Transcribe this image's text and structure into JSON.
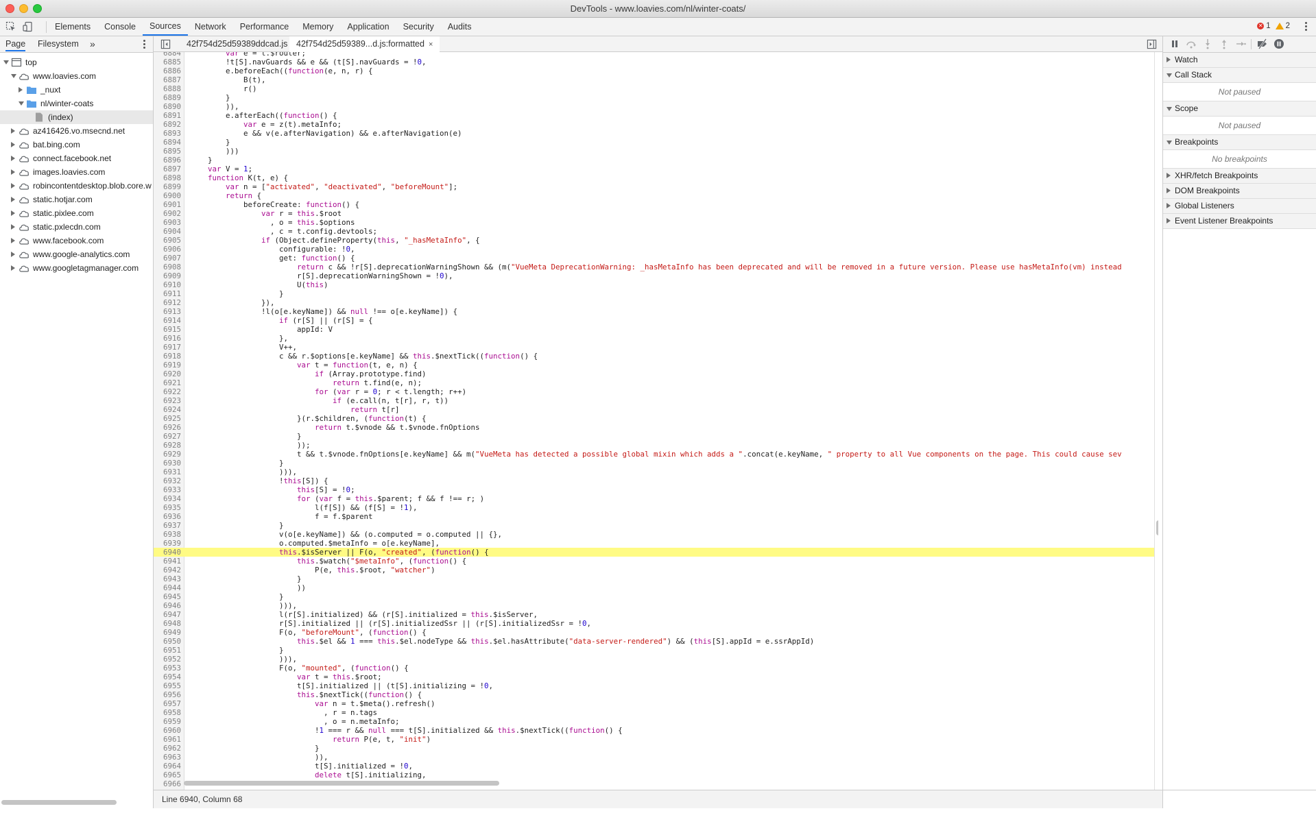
{
  "window": {
    "title": "DevTools - www.loavies.com/nl/winter-coats/"
  },
  "toolbar": {
    "tabs": [
      "Elements",
      "Console",
      "Sources",
      "Network",
      "Performance",
      "Memory",
      "Application",
      "Security",
      "Audits"
    ],
    "active_tab": "Sources",
    "errors": "1",
    "warnings": "2"
  },
  "navigator": {
    "tabs": [
      "Page",
      "Filesystem"
    ],
    "more": "»",
    "tree": [
      {
        "label": "top",
        "level": 0,
        "expanded": true,
        "icon": "frame"
      },
      {
        "label": "www.loavies.com",
        "level": 1,
        "expanded": true,
        "icon": "cloud"
      },
      {
        "label": "_nuxt",
        "level": 2,
        "expanded": false,
        "icon": "folder"
      },
      {
        "label": "nl/winter-coats",
        "level": 2,
        "expanded": true,
        "icon": "folder"
      },
      {
        "label": "(index)",
        "level": 3,
        "icon": "file",
        "selected": true
      },
      {
        "label": "az416426.vo.msecnd.net",
        "level": 1,
        "expanded": false,
        "icon": "cloud"
      },
      {
        "label": "bat.bing.com",
        "level": 1,
        "expanded": false,
        "icon": "cloud"
      },
      {
        "label": "connect.facebook.net",
        "level": 1,
        "expanded": false,
        "icon": "cloud"
      },
      {
        "label": "images.loavies.com",
        "level": 1,
        "expanded": false,
        "icon": "cloud"
      },
      {
        "label": "robincontentdesktop.blob.core.w",
        "level": 1,
        "expanded": false,
        "icon": "cloud"
      },
      {
        "label": "static.hotjar.com",
        "level": 1,
        "expanded": false,
        "icon": "cloud"
      },
      {
        "label": "static.pixlee.com",
        "level": 1,
        "expanded": false,
        "icon": "cloud"
      },
      {
        "label": "static.pxlecdn.com",
        "level": 1,
        "expanded": false,
        "icon": "cloud"
      },
      {
        "label": "www.facebook.com",
        "level": 1,
        "expanded": false,
        "icon": "cloud"
      },
      {
        "label": "www.google-analytics.com",
        "level": 1,
        "expanded": false,
        "icon": "cloud"
      },
      {
        "label": "www.googletagmanager.com",
        "level": 1,
        "expanded": false,
        "icon": "cloud"
      }
    ]
  },
  "editor": {
    "tabs": [
      {
        "label": "42f754d25d59389ddcad.js",
        "closable": false
      },
      {
        "label": "42f754d25d59389...d.js:formatted",
        "closable": true,
        "close": "×"
      }
    ],
    "status": "Line 6940, Column 68",
    "highlighted_line": 6940,
    "lines": [
      {
        "n": "6884",
        "t": "        var e = t.$router;"
      },
      {
        "n": "6885",
        "t": "        !t[S].navGuards && e && (t[S].navGuards = !0,"
      },
      {
        "n": "6886",
        "t": "        e.beforeEach((function(e, n, r) {"
      },
      {
        "n": "6887",
        "t": "            B(t),"
      },
      {
        "n": "6888",
        "t": "            r()"
      },
      {
        "n": "6889",
        "t": "        }"
      },
      {
        "n": "6890",
        "t": "        )),"
      },
      {
        "n": "6891",
        "t": "        e.afterEach((function() {"
      },
      {
        "n": "6892",
        "t": "            var e = z(t).metaInfo;"
      },
      {
        "n": "6893",
        "t": "            e && v(e.afterNavigation) && e.afterNavigation(e)"
      },
      {
        "n": "6894",
        "t": "        }"
      },
      {
        "n": "6895",
        "t": "        )))"
      },
      {
        "n": "6896",
        "t": "    }"
      },
      {
        "n": "6897",
        "t": "    var V = 1;"
      },
      {
        "n": "6898",
        "t": "    function K(t, e) {"
      },
      {
        "n": "6899",
        "t": "        var n = [\"activated\", \"deactivated\", \"beforeMount\"];"
      },
      {
        "n": "6900",
        "t": "        return {"
      },
      {
        "n": "6901",
        "t": "            beforeCreate: function() {"
      },
      {
        "n": "6902",
        "t": "                var r = this.$root"
      },
      {
        "n": "6903",
        "t": "                  , o = this.$options"
      },
      {
        "n": "6904",
        "t": "                  , c = t.config.devtools;"
      },
      {
        "n": "6905",
        "t": "                if (Object.defineProperty(this, \"_hasMetaInfo\", {"
      },
      {
        "n": "6906",
        "t": "                    configurable: !0,"
      },
      {
        "n": "6907",
        "t": "                    get: function() {"
      },
      {
        "n": "6908",
        "t": "                        return c && !r[S].deprecationWarningShown && (m(\"VueMeta DeprecationWarning: _hasMetaInfo has been deprecated and will be removed in a future version. Please use hasMetaInfo(vm) instead"
      },
      {
        "n": "6909",
        "t": "                        r[S].deprecationWarningShown = !0),"
      },
      {
        "n": "6910",
        "t": "                        U(this)"
      },
      {
        "n": "6911",
        "t": "                    }"
      },
      {
        "n": "6912",
        "t": "                }),"
      },
      {
        "n": "6913",
        "t": "                !l(o[e.keyName]) && null !== o[e.keyName]) {"
      },
      {
        "n": "6914",
        "t": "                    if (r[S] || (r[S] = {"
      },
      {
        "n": "6915",
        "t": "                        appId: V"
      },
      {
        "n": "6916",
        "t": "                    },"
      },
      {
        "n": "6917",
        "t": "                    V++,"
      },
      {
        "n": "6918",
        "t": "                    c && r.$options[e.keyName] && this.$nextTick((function() {"
      },
      {
        "n": "6919",
        "t": "                        var t = function(t, e, n) {"
      },
      {
        "n": "6920",
        "t": "                            if (Array.prototype.find)"
      },
      {
        "n": "6921",
        "t": "                                return t.find(e, n);"
      },
      {
        "n": "6922",
        "t": "                            for (var r = 0; r < t.length; r++)"
      },
      {
        "n": "6923",
        "t": "                                if (e.call(n, t[r], r, t))"
      },
      {
        "n": "6924",
        "t": "                                    return t[r]"
      },
      {
        "n": "6925",
        "t": "                        }(r.$children, (function(t) {"
      },
      {
        "n": "6926",
        "t": "                            return t.$vnode && t.$vnode.fnOptions"
      },
      {
        "n": "6927",
        "t": "                        }"
      },
      {
        "n": "6928",
        "t": "                        ));"
      },
      {
        "n": "6929",
        "t": "                        t && t.$vnode.fnOptions[e.keyName] && m(\"VueMeta has detected a possible global mixin which adds a \".concat(e.keyName, \" property to all Vue components on the page. This could cause sev"
      },
      {
        "n": "6930",
        "t": "                    }"
      },
      {
        "n": "6931",
        "t": "                    ))),"
      },
      {
        "n": "6932",
        "t": "                    !this[S]) {"
      },
      {
        "n": "6933",
        "t": "                        this[S] = !0;"
      },
      {
        "n": "6934",
        "t": "                        for (var f = this.$parent; f && f !== r; )"
      },
      {
        "n": "6935",
        "t": "                            l(f[S]) && (f[S] = !1),"
      },
      {
        "n": "6936",
        "t": "                            f = f.$parent"
      },
      {
        "n": "6937",
        "t": "                    }"
      },
      {
        "n": "6938",
        "t": "                    v(o[e.keyName]) && (o.computed = o.computed || {},"
      },
      {
        "n": "6939",
        "t": "                    o.computed.$metaInfo = o[e.keyName],"
      },
      {
        "n": "6940",
        "t": "                    this.$isServer || F(o, \"created\", (function() {"
      },
      {
        "n": "6941",
        "t": "                        this.$watch(\"$metaInfo\", (function() {"
      },
      {
        "n": "6942",
        "t": "                            P(e, this.$root, \"watcher\")"
      },
      {
        "n": "6943",
        "t": "                        }"
      },
      {
        "n": "6944",
        "t": "                        ))"
      },
      {
        "n": "6945",
        "t": "                    }"
      },
      {
        "n": "6946",
        "t": "                    ))),"
      },
      {
        "n": "6947",
        "t": "                    l(r[S].initialized) && (r[S].initialized = this.$isServer,"
      },
      {
        "n": "6948",
        "t": "                    r[S].initialized || (r[S].initializedSsr || (r[S].initializedSsr = !0,"
      },
      {
        "n": "6949",
        "t": "                    F(o, \"beforeMount\", (function() {"
      },
      {
        "n": "6950",
        "t": "                        this.$el && 1 === this.$el.nodeType && this.$el.hasAttribute(\"data-server-rendered\") && (this[S].appId = e.ssrAppId)"
      },
      {
        "n": "6951",
        "t": "                    }"
      },
      {
        "n": "6952",
        "t": "                    ))),"
      },
      {
        "n": "6953",
        "t": "                    F(o, \"mounted\", (function() {"
      },
      {
        "n": "6954",
        "t": "                        var t = this.$root;"
      },
      {
        "n": "6955",
        "t": "                        t[S].initialized || (t[S].initializing = !0,"
      },
      {
        "n": "6956",
        "t": "                        this.$nextTick((function() {"
      },
      {
        "n": "6957",
        "t": "                            var n = t.$meta().refresh()"
      },
      {
        "n": "6958",
        "t": "                              , r = n.tags"
      },
      {
        "n": "6959",
        "t": "                              , o = n.metaInfo;"
      },
      {
        "n": "6960",
        "t": "                            !1 === r && null === t[S].initialized && this.$nextTick((function() {"
      },
      {
        "n": "6961",
        "t": "                                return P(e, t, \"init\")"
      },
      {
        "n": "6962",
        "t": "                            }"
      },
      {
        "n": "6963",
        "t": "                            )),"
      },
      {
        "n": "6964",
        "t": "                            t[S].initialized = !0,"
      },
      {
        "n": "6965",
        "t": "                            delete t[S].initializing,"
      },
      {
        "n": "6966",
        "t": ""
      }
    ]
  },
  "debugger": {
    "sections": [
      {
        "label": "Watch",
        "expanded": false
      },
      {
        "label": "Call Stack",
        "expanded": true,
        "body": "Not paused"
      },
      {
        "label": "Scope",
        "expanded": true,
        "body": "Not paused"
      },
      {
        "label": "Breakpoints",
        "expanded": true,
        "body": "No breakpoints"
      },
      {
        "label": "XHR/fetch Breakpoints",
        "expanded": false
      },
      {
        "label": "DOM Breakpoints",
        "expanded": false
      },
      {
        "label": "Global Listeners",
        "expanded": false
      },
      {
        "label": "Event Listener Breakpoints",
        "expanded": false
      }
    ]
  },
  "colors": {
    "accent": "#1a73e8",
    "highlight": "#fffb84",
    "keyword": "#aa0d91",
    "string": "#c41a16",
    "number": "#1c00cf"
  }
}
